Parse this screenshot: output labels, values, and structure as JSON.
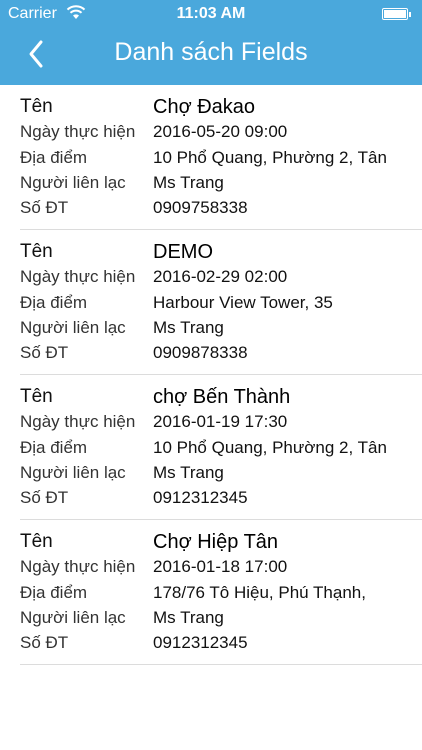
{
  "status_bar": {
    "carrier": "Carrier",
    "time": "11:03 AM"
  },
  "header": {
    "title": "Danh sách Fields",
    "back_icon": "chevron-left-icon"
  },
  "labels": {
    "name": "Tên",
    "date": "Ngày thực hiện",
    "location": "Địa điểm",
    "contact": "Người liên lạc",
    "phone": "Số ĐT"
  },
  "items": [
    {
      "name": "Chợ Đakao",
      "date": "2016-05-20 09:00",
      "location": "10 Phổ Quang, Phường 2, Tân",
      "contact": "Ms Trang",
      "phone": "0909758338"
    },
    {
      "name": "DEMO",
      "date": "2016-02-29 02:00",
      "location": "Harbour View Tower, 35",
      "contact": "Ms Trang",
      "phone": "0909878338"
    },
    {
      "name": "chợ Bến Thành",
      "date": "2016-01-19 17:30",
      "location": "10 Phổ Quang, Phường 2, Tân",
      "contact": "Ms Trang",
      "phone": "0912312345"
    },
    {
      "name": "Chợ Hiệp Tân",
      "date": "2016-01-18 17:00",
      "location": "178/76 Tô Hiệu, Phú Thạnh,",
      "contact": "Ms Trang",
      "phone": "0912312345"
    }
  ]
}
